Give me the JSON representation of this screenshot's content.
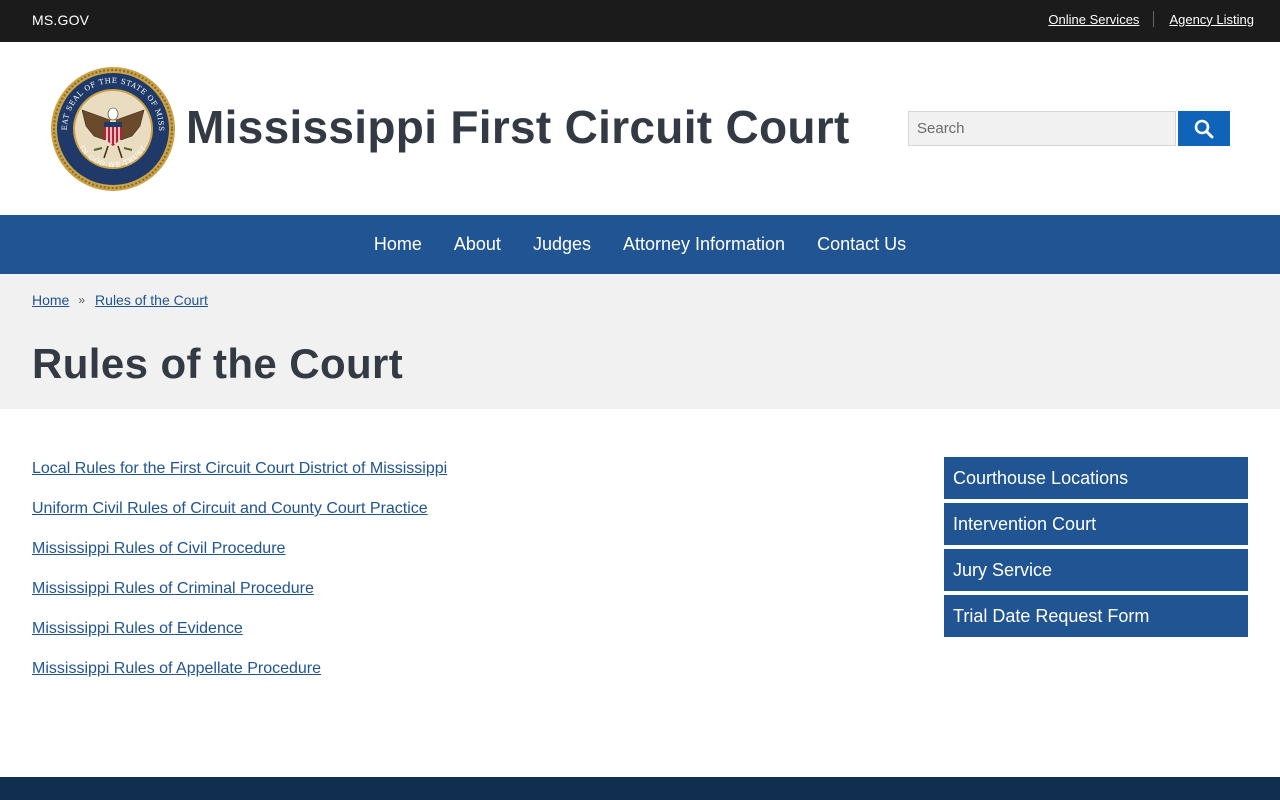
{
  "utility": {
    "msgov": "MS.GOV",
    "links": [
      "Online Services",
      "Agency Listing"
    ]
  },
  "header": {
    "site_title": "Mississippi First Circuit Court",
    "seal_outer_text": "THE GREAT SEAL OF THE STATE OF MISSISSIPPI",
    "seal_motto": "IN GOD WE TRUST",
    "search_placeholder": "Search"
  },
  "nav": {
    "items": [
      "Home",
      "About",
      "Judges",
      "Attorney Information",
      "Contact Us"
    ]
  },
  "breadcrumb": {
    "home": "Home",
    "separator": "»",
    "current": "Rules of the Court"
  },
  "page": {
    "title": "Rules of the Court"
  },
  "content": {
    "links": [
      "Local Rules for the First Circuit Court District of Mississippi",
      "Uniform Civil Rules of Circuit and County Court Practice",
      "Mississippi Rules of Civil Procedure",
      "Mississippi Rules of Criminal Procedure",
      "Mississippi Rules of Evidence",
      "Mississippi Rules of Appellate Procedure"
    ]
  },
  "sidebar": {
    "items": [
      "Courthouse Locations",
      "Intervention Court",
      "Jury Service",
      "Trial Date Request Form"
    ]
  },
  "colors": {
    "utility_bar": "#1b1b1b",
    "nav": "#205493",
    "search_button": "#0f63b8",
    "link": "#205493",
    "footer": "#112e51"
  }
}
